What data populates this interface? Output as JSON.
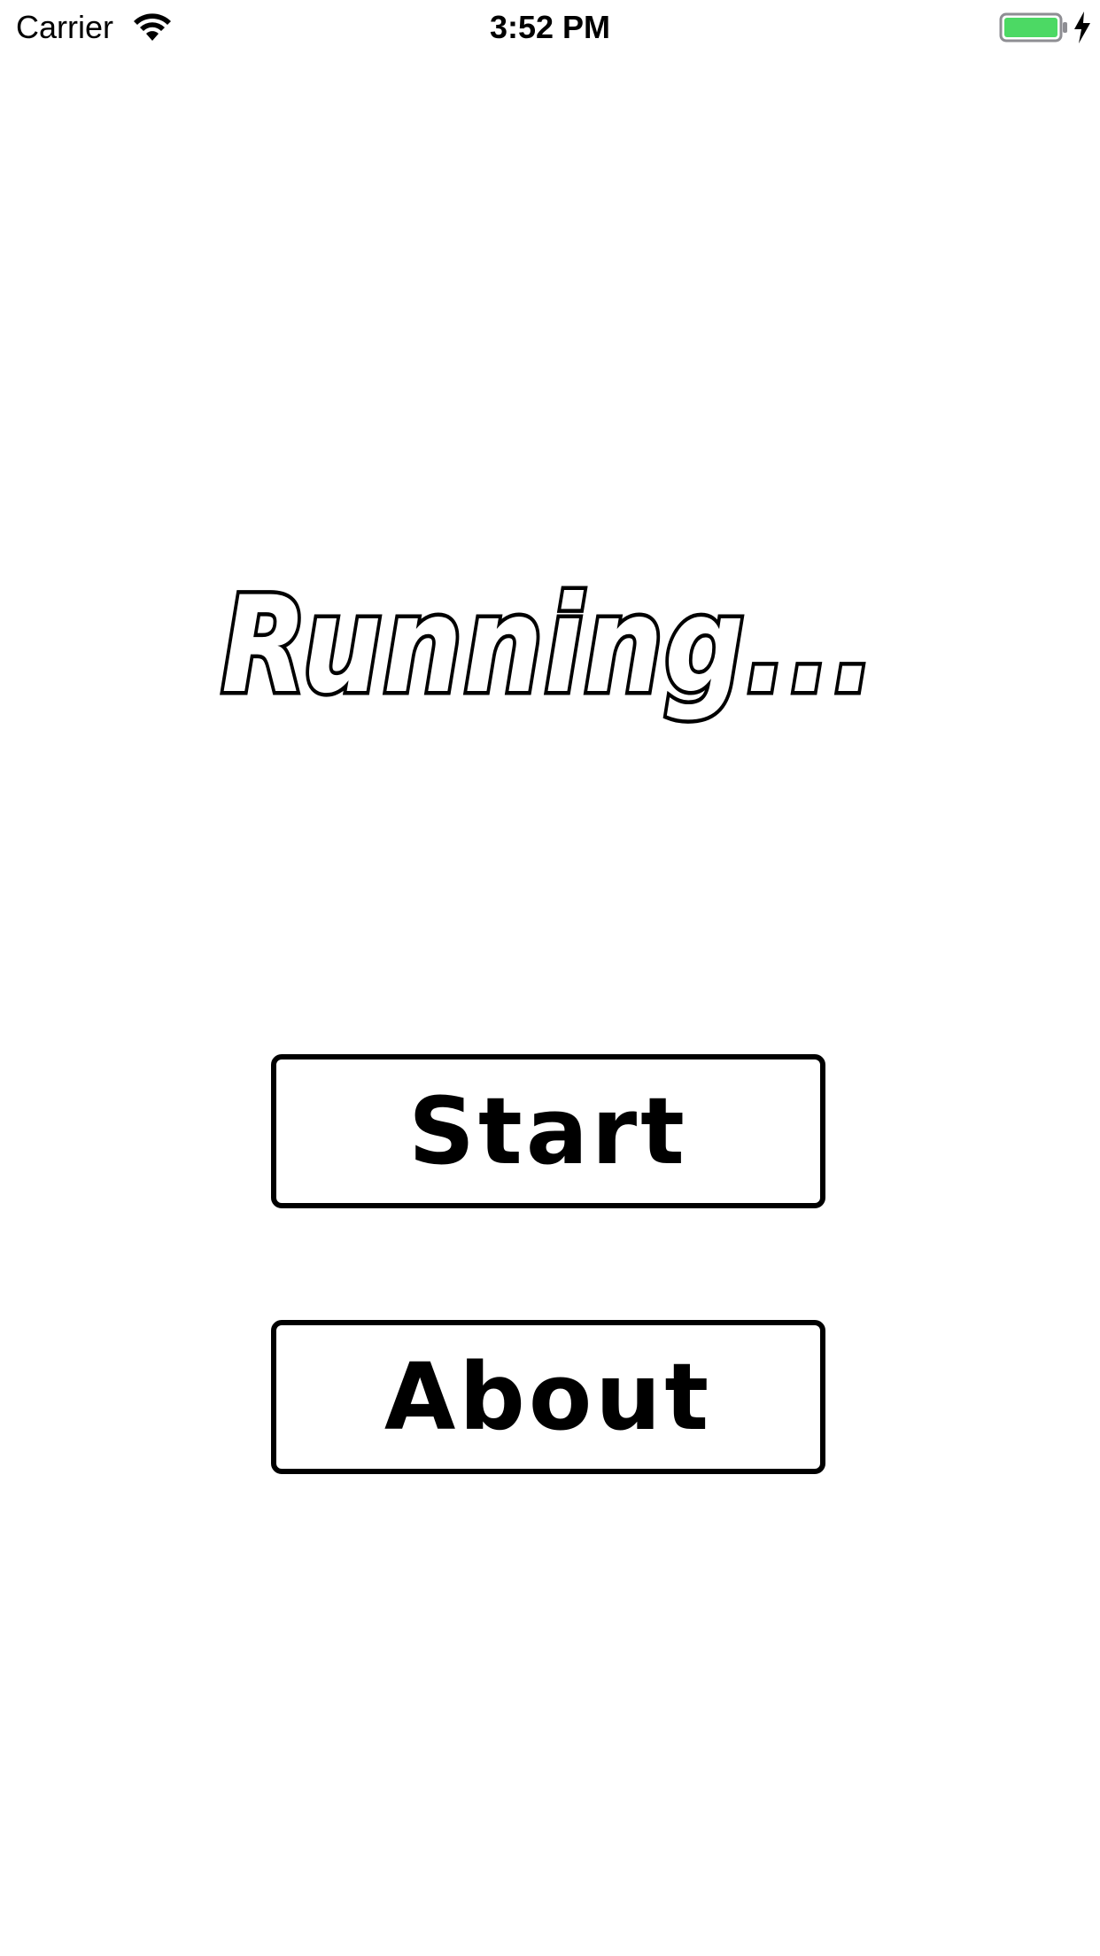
{
  "status_bar": {
    "carrier": "Carrier",
    "time": "3:52 PM",
    "wifi_icon": "wifi-icon",
    "battery_icon": "battery-icon",
    "charging_icon": "charging-bolt-icon",
    "battery_color": "#4cd964"
  },
  "title": {
    "text": "Running..."
  },
  "menu": {
    "start_label": "Start",
    "about_label": "About"
  }
}
